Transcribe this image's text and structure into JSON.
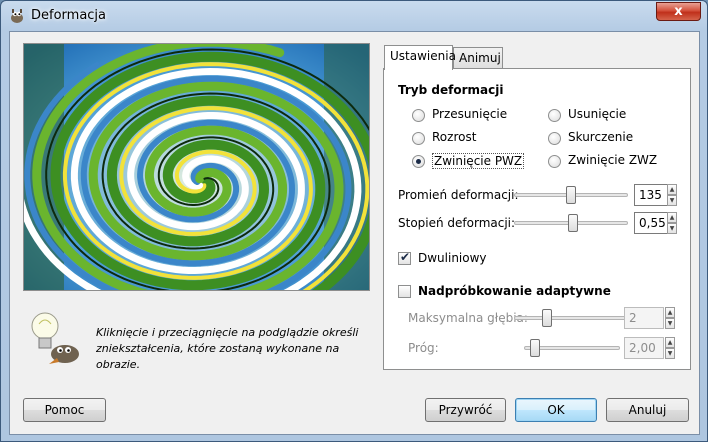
{
  "window": {
    "title": "Deformacja",
    "close_symbol": "x"
  },
  "hint": {
    "line1": "Kliknięcie i przeciągnięcie na podglądzie określi",
    "line2": "zniekształcenia, które zostaną wykonane na obrazie."
  },
  "tabs": [
    {
      "label": "Ustawienia",
      "active": true
    },
    {
      "label": "Animuj",
      "active": false
    }
  ],
  "mode_group": {
    "title": "Tryb deformacji",
    "options": [
      {
        "label": "Przesunięcie",
        "checked": false
      },
      {
        "label": "Usunięcie",
        "checked": false
      },
      {
        "label": "Rozrost",
        "checked": false
      },
      {
        "label": "Skurczenie",
        "checked": false
      },
      {
        "label": "Zwinięcie PWZ",
        "checked": true
      },
      {
        "label": "Zwinięcie ZWZ",
        "checked": false
      }
    ]
  },
  "radius": {
    "label": "Promień deformacji:",
    "value": "135",
    "fraction": 0.5
  },
  "amount": {
    "label": "Stopień deformacji:",
    "value": "0,55",
    "fraction": 0.55
  },
  "bilinear": {
    "label": "Dwuliniowy",
    "checked": true
  },
  "supersample": {
    "label": "Nadpróbkowanie adaptywne",
    "checked": false,
    "max_depth": {
      "label": "Maksymalna głębia:",
      "value": "2",
      "fraction": 0.2
    },
    "threshold": {
      "label": "Próg:",
      "value": "2,00",
      "fraction": 0.05
    }
  },
  "buttons": {
    "help": "Pomoc",
    "reset": "Przywróć",
    "ok": "OK",
    "cancel": "Anuluj"
  },
  "colors": {
    "selection_blue": "#3c7fb1",
    "title_close_red": "#c0301b"
  }
}
